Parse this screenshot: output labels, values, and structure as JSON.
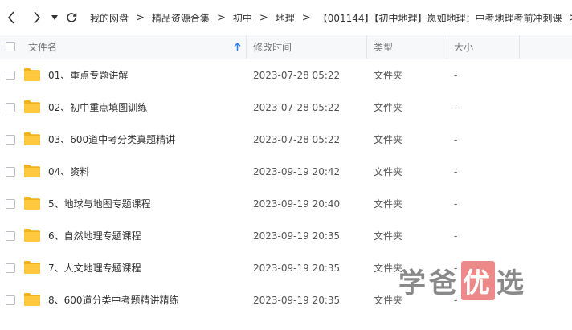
{
  "breadcrumb": [
    "我的网盘",
    "精品资源合集",
    "初中",
    "地理",
    "【001144】【初中地理】岚如地理：中考地理考前冲刺课"
  ],
  "breadcrumb_separator": ">",
  "columns": {
    "name": "文件名",
    "modified": "修改时间",
    "type": "类型",
    "size": "大小"
  },
  "rows": [
    {
      "name": "01、重点专题讲解",
      "modified": "2023-07-28 05:22",
      "type": "文件夹",
      "size": "-"
    },
    {
      "name": "02、初中重点填图训练",
      "modified": "2023-07-28 05:22",
      "type": "文件夹",
      "size": "-"
    },
    {
      "name": "03、600道中考分类真题精讲",
      "modified": "2023-07-28 05:22",
      "type": "文件夹",
      "size": "-"
    },
    {
      "name": "04、资料",
      "modified": "2023-09-19 20:42",
      "type": "文件夹",
      "size": "-"
    },
    {
      "name": "5、地球与地图专题课程",
      "modified": "2023-09-19 20:40",
      "type": "文件夹",
      "size": "-"
    },
    {
      "name": "6、自然地理专题课程",
      "modified": "2023-09-19 20:35",
      "type": "文件夹",
      "size": "-"
    },
    {
      "name": "7、人文地理专题课程",
      "modified": "2023-09-19 20:35",
      "type": "文件夹",
      "size": "-"
    },
    {
      "name": "8、600道分类中考题精讲精练",
      "modified": "2023-09-19 20:35",
      "type": "文件夹",
      "size": "-"
    }
  ],
  "watermark": {
    "part1": "学爸",
    "highlight": "优",
    "part2": "选"
  },
  "colors": {
    "folder": "#ffc83d",
    "folder_dark": "#f5b21b",
    "sort_arrow": "#2f80ed"
  },
  "icons": {
    "back": "chevron-left",
    "forward": "chevron-right",
    "dropdown": "caret-down",
    "refresh": "refresh",
    "sort": "arrow-up"
  }
}
